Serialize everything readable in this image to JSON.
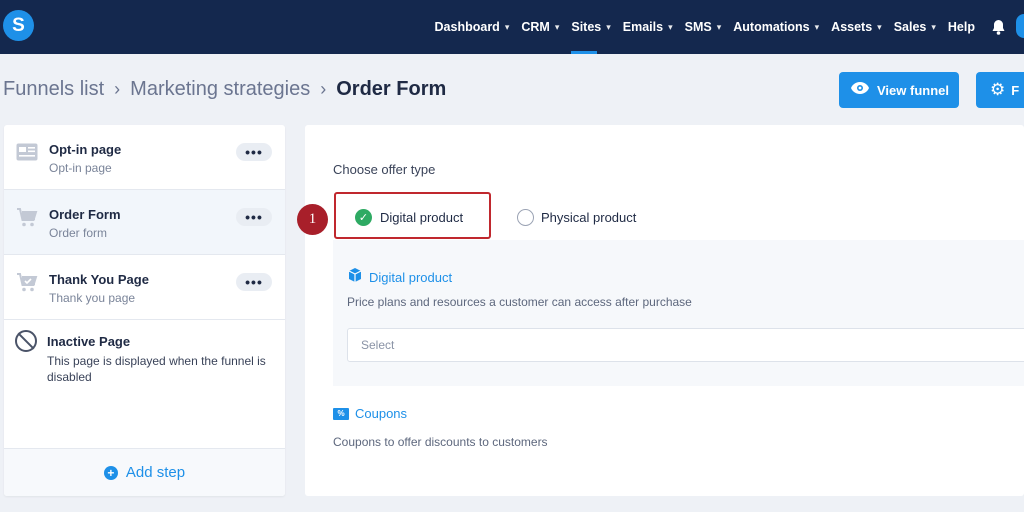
{
  "app": {
    "logo_letter": "S"
  },
  "nav": {
    "items": [
      {
        "label": "Dashboard",
        "has_menu": true
      },
      {
        "label": "CRM",
        "has_menu": true
      },
      {
        "label": "Sites",
        "has_menu": true,
        "active": true
      },
      {
        "label": "Emails",
        "has_menu": true
      },
      {
        "label": "SMS",
        "has_menu": true
      },
      {
        "label": "Automations",
        "has_menu": true
      },
      {
        "label": "Assets",
        "has_menu": true
      },
      {
        "label": "Sales",
        "has_menu": true
      },
      {
        "label": "Help",
        "has_menu": false
      }
    ],
    "chevron": "⌄",
    "bell_icon": "bell-icon"
  },
  "breadcrumb": {
    "items": [
      "Funnels list",
      "Marketing strategies",
      "Order Form"
    ],
    "separator": "›"
  },
  "actions": {
    "view_funnel": "View funnel",
    "settings_label_partial": "F"
  },
  "steps": [
    {
      "title": "Opt-in page",
      "subtitle": "Opt-in page",
      "icon": "form-page-icon",
      "menu": "•••"
    },
    {
      "title": "Order Form",
      "subtitle": "Order form",
      "icon": "cart-icon",
      "menu": "•••",
      "selected": true
    },
    {
      "title": "Thank You Page",
      "subtitle": "Thank you page",
      "icon": "cart-check-icon",
      "menu": "•••"
    },
    {
      "title": "Inactive Page",
      "description": "This page is displayed when the funnel is disabled",
      "icon": "ban-icon"
    }
  ],
  "add_step": "Add step",
  "offer": {
    "label": "Choose offer type",
    "options": [
      {
        "label": "Digital product",
        "selected": true
      },
      {
        "label": "Physical product",
        "selected": false
      }
    ],
    "step_marker": "1"
  },
  "digital": {
    "title": "Digital product",
    "description": "Price plans and resources a customer can access after purchase",
    "select_placeholder": "Select"
  },
  "coupons": {
    "title": "Coupons",
    "description": "Coupons to offer discounts to customers"
  },
  "colors": {
    "topbar": "#14284e",
    "accent": "#1e90e8",
    "success": "#2eaa63",
    "highlight": "#c0282e"
  }
}
